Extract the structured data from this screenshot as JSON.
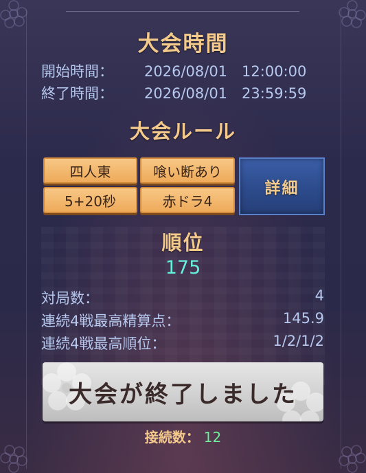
{
  "schedule": {
    "title": "大会時間",
    "start_label": "開始時間：",
    "start_value": "2026/08/01　12:00:00",
    "end_label": "終了時間：",
    "end_value": "2026/08/01　23:59:59"
  },
  "rules": {
    "title": "大会ルール",
    "tags": [
      "四人東",
      "喰い断あり",
      "5+20秒",
      "赤ドラ4"
    ],
    "detail_label": "詳細"
  },
  "ranking": {
    "title": "順位",
    "value": "175",
    "stats": [
      {
        "label": "対局数：",
        "value": "4"
      },
      {
        "label": "連続4戦最高精算点：",
        "value": "145.9"
      },
      {
        "label": "連続4戦最高順位：",
        "value": "1/2/1/2"
      }
    ]
  },
  "footer": {
    "end_button_label": "大会が終了しました",
    "connections_label": "接続数：",
    "connections_value": "12"
  },
  "colors": {
    "title": "#f4c98c",
    "text": "#b7c8ee",
    "rank": "#66f0dc",
    "connections": "#6ef09a",
    "tag_bg": "#eeaa5a",
    "detail_bg": "#2d4b8c"
  },
  "icons": [
    "cherry-blossom-icon"
  ]
}
